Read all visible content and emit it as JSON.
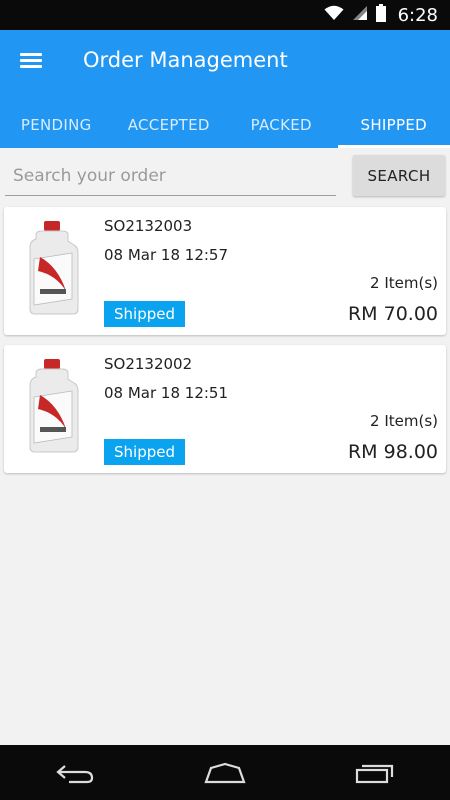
{
  "status_bar": {
    "time": "6:28"
  },
  "app_bar": {
    "title": "Order Management"
  },
  "tabs": [
    {
      "label": "PENDING"
    },
    {
      "label": "ACCEPTED"
    },
    {
      "label": "PACKED"
    },
    {
      "label": "SHIPPED",
      "active": true
    }
  ],
  "search": {
    "placeholder": "Search your order",
    "value": "",
    "button_label": "SEARCH"
  },
  "orders": [
    {
      "id": "SO2132003",
      "date": "08 Mar 18 12:57",
      "items": "2 Item(s)",
      "status": "Shipped",
      "total": "RM 70.00",
      "thumb_icon": "oil-bottle-icon"
    },
    {
      "id": "SO2132002",
      "date": "08 Mar 18 12:51",
      "items": "2 Item(s)",
      "status": "Shipped",
      "total": "RM 98.00",
      "thumb_icon": "oil-bottle-icon"
    }
  ],
  "colors": {
    "primary": "#2196f3",
    "status_badge": "#0aa3f0",
    "background": "#f2f2f2"
  },
  "nav_bar": {
    "icons": [
      "back-icon",
      "home-icon",
      "recent-apps-icon"
    ]
  }
}
